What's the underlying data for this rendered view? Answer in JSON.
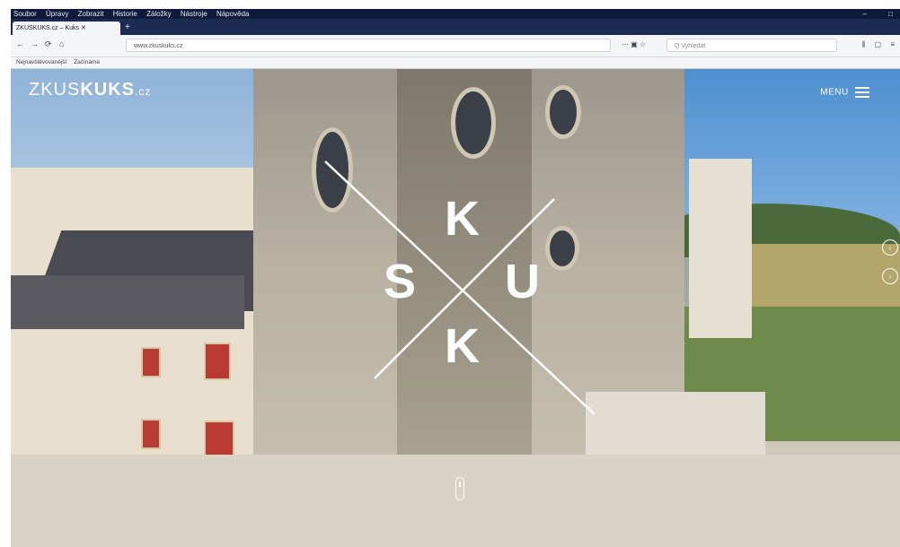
{
  "os_menu": {
    "items": [
      "Soubor",
      "Úpravy",
      "Zobrazit",
      "Historie",
      "Záložky",
      "Nástroje",
      "Nápověda"
    ],
    "minimize": "–",
    "maximize": "□"
  },
  "tab": {
    "title": "ZKUSKUKS.cz – Kuks ✕",
    "close": "✕",
    "new_tab": "+"
  },
  "nav": {
    "back": "←",
    "forward": "→",
    "reload": "⟳",
    "home": "⌂",
    "url": "www.zkuskuks.cz",
    "page_actions": "⋯ ▣ ☆",
    "search_placeholder": "Q Vyhledat"
  },
  "toolbar_right": [
    "⫼",
    "▢",
    "≡"
  ],
  "bookmarks": [
    "Nejnavštěvovanější",
    "Začínáme"
  ],
  "hero": {
    "logo_main": "ZKUS",
    "logo_bold": "KUKS",
    "logo_suffix": ".cz",
    "menu_label": "MENU",
    "letters": {
      "top": "K",
      "left": "S",
      "right": "U",
      "bottom": "K"
    },
    "prev_icon": "‹",
    "next_icon": "›"
  },
  "colors": {
    "browser_dark": "#0f1a3a",
    "tab_strip": "#1d2a52",
    "toolbar": "#f4f5f7",
    "overlay_text": "#ffffff"
  }
}
